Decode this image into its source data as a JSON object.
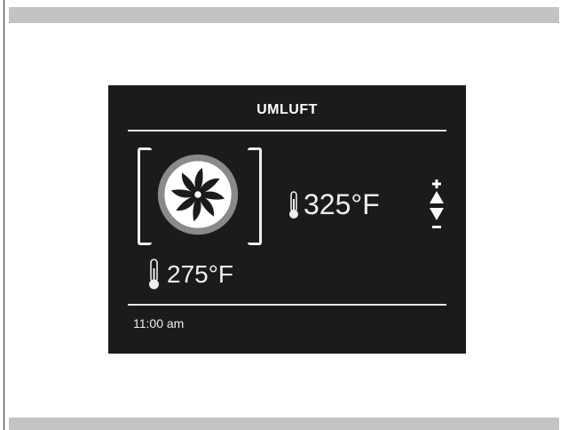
{
  "panel": {
    "mode_title": "UMLUFT",
    "mode_icon": "convection-fan-icon",
    "set_temperature": "325°F",
    "current_temperature": "275°F",
    "time": "11:00 am"
  },
  "colors": {
    "panel_background": "#1b1b1b",
    "panel_text": "#eeeeee",
    "fan_ring": "#8a8a8a",
    "page_bars": "#c3c3c3"
  }
}
